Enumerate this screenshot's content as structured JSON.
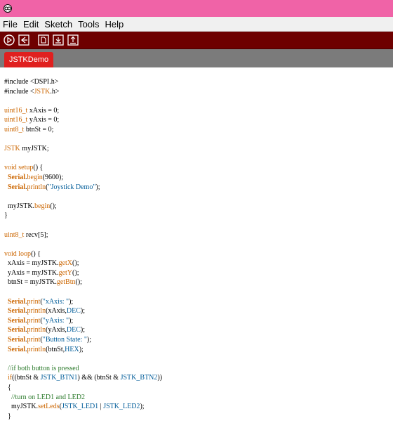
{
  "menu": [
    "File",
    "Edit",
    "Sketch",
    "Tools",
    "Help"
  ],
  "toolbar": [
    {
      "name": "verify-button",
      "icon": "play-icon"
    },
    {
      "name": "upload-button",
      "icon": "upload-arrow-icon"
    },
    {
      "name": "new-button",
      "icon": "new-file-icon"
    },
    {
      "name": "open-button",
      "icon": "open-icon"
    },
    {
      "name": "save-button",
      "icon": "save-icon"
    }
  ],
  "tab": {
    "label": "JSTKDemo"
  },
  "colors": {
    "titlebar": "#f063a7",
    "toolbar": "#6e0000",
    "tabbar": "#7b7b7b",
    "tab": "#e0201f",
    "keyword": "#cc6600",
    "string": "#005c99",
    "comment": "#2b7a2b"
  },
  "code": [
    [
      [
        "tx",
        "#include <DSPI.h>"
      ]
    ],
    [
      [
        "tx",
        "#include <"
      ],
      [
        "kw",
        "JSTK"
      ],
      [
        "tx",
        ".h>"
      ]
    ],
    [],
    [
      [
        "kw",
        "uint16_t"
      ],
      [
        "tx",
        " xAxis = 0;"
      ]
    ],
    [
      [
        "kw",
        "uint16_t"
      ],
      [
        "tx",
        " yAxis = 0;"
      ]
    ],
    [
      [
        "kw",
        "uint8_t"
      ],
      [
        "tx",
        " btnSt = 0;"
      ]
    ],
    [],
    [
      [
        "kw",
        "JSTK"
      ],
      [
        "tx",
        " myJSTK;"
      ]
    ],
    [],
    [
      [
        "kw",
        "void"
      ],
      [
        "tx",
        " "
      ],
      [
        "kw",
        "setup"
      ],
      [
        "tx",
        "() {"
      ]
    ],
    [
      [
        "tx",
        "  "
      ],
      [
        "fnb",
        "Serial"
      ],
      [
        "tx",
        "."
      ],
      [
        "fn",
        "begin"
      ],
      [
        "tx",
        "(9600);"
      ]
    ],
    [
      [
        "tx",
        "  "
      ],
      [
        "fnb",
        "Serial"
      ],
      [
        "tx",
        "."
      ],
      [
        "fn",
        "println"
      ],
      [
        "tx",
        "("
      ],
      [
        "str",
        "\"Joystick Demo\""
      ],
      [
        "tx",
        ");"
      ]
    ],
    [],
    [
      [
        "tx",
        "  myJSTK."
      ],
      [
        "fn",
        "begin"
      ],
      [
        "tx",
        "();"
      ]
    ],
    [
      [
        "tx",
        "}"
      ]
    ],
    [],
    [
      [
        "kw",
        "uint8_t"
      ],
      [
        "tx",
        " recv[5];"
      ]
    ],
    [],
    [
      [
        "kw",
        "void"
      ],
      [
        "tx",
        " "
      ],
      [
        "kw",
        "loop"
      ],
      [
        "tx",
        "() {"
      ]
    ],
    [
      [
        "tx",
        "  xAxis = myJSTK."
      ],
      [
        "fn",
        "getX"
      ],
      [
        "tx",
        "();"
      ]
    ],
    [
      [
        "tx",
        "  yAxis = myJSTK."
      ],
      [
        "fn",
        "getY"
      ],
      [
        "tx",
        "();"
      ]
    ],
    [
      [
        "tx",
        "  btnSt = myJSTK."
      ],
      [
        "fn",
        "getBtn"
      ],
      [
        "tx",
        "();"
      ]
    ],
    [],
    [
      [
        "tx",
        "  "
      ],
      [
        "fnb",
        "Serial"
      ],
      [
        "tx",
        "."
      ],
      [
        "fn",
        "print"
      ],
      [
        "tx",
        "("
      ],
      [
        "str",
        "\"xAxis: \""
      ],
      [
        "tx",
        ");"
      ]
    ],
    [
      [
        "tx",
        "  "
      ],
      [
        "fnb",
        "Serial"
      ],
      [
        "tx",
        "."
      ],
      [
        "fn",
        "println"
      ],
      [
        "tx",
        "(xAxis,"
      ],
      [
        "const",
        "DEC"
      ],
      [
        "tx",
        ");"
      ]
    ],
    [
      [
        "tx",
        "  "
      ],
      [
        "fnb",
        "Serial"
      ],
      [
        "tx",
        "."
      ],
      [
        "fn",
        "print"
      ],
      [
        "tx",
        "("
      ],
      [
        "str",
        "\"yAxis: \""
      ],
      [
        "tx",
        ");"
      ]
    ],
    [
      [
        "tx",
        "  "
      ],
      [
        "fnb",
        "Serial"
      ],
      [
        "tx",
        "."
      ],
      [
        "fn",
        "println"
      ],
      [
        "tx",
        "(yAxis,"
      ],
      [
        "const",
        "DEC"
      ],
      [
        "tx",
        ");"
      ]
    ],
    [
      [
        "tx",
        "  "
      ],
      [
        "fnb",
        "Serial"
      ],
      [
        "tx",
        "."
      ],
      [
        "fn",
        "print"
      ],
      [
        "tx",
        "("
      ],
      [
        "str",
        "\"Button State: \""
      ],
      [
        "tx",
        ");"
      ]
    ],
    [
      [
        "tx",
        "  "
      ],
      [
        "fnb",
        "Serial"
      ],
      [
        "tx",
        "."
      ],
      [
        "fn",
        "println"
      ],
      [
        "tx",
        "(btnSt,"
      ],
      [
        "const",
        "HEX"
      ],
      [
        "tx",
        ");"
      ]
    ],
    [],
    [
      [
        "cm2",
        "  //if both button is pressed"
      ]
    ],
    [
      [
        "tx",
        "  "
      ],
      [
        "kw",
        "if"
      ],
      [
        "tx",
        "((btnSt & "
      ],
      [
        "const",
        "JSTK_BTN1"
      ],
      [
        "tx",
        ") && (btnSt & "
      ],
      [
        "const",
        "JSTK_BTN2"
      ],
      [
        "tx",
        "))"
      ]
    ],
    [
      [
        "tx",
        "  {"
      ]
    ],
    [
      [
        "cm2",
        "    //turn on LED1 and LED2"
      ]
    ],
    [
      [
        "tx",
        "    myJSTK."
      ],
      [
        "fn",
        "setLeds"
      ],
      [
        "tx",
        "("
      ],
      [
        "const",
        "JSTK_LED1"
      ],
      [
        "tx",
        " | "
      ],
      [
        "const",
        "JSTK_LED2"
      ],
      [
        "tx",
        ");"
      ]
    ],
    [
      [
        "tx",
        "  }"
      ]
    ]
  ]
}
